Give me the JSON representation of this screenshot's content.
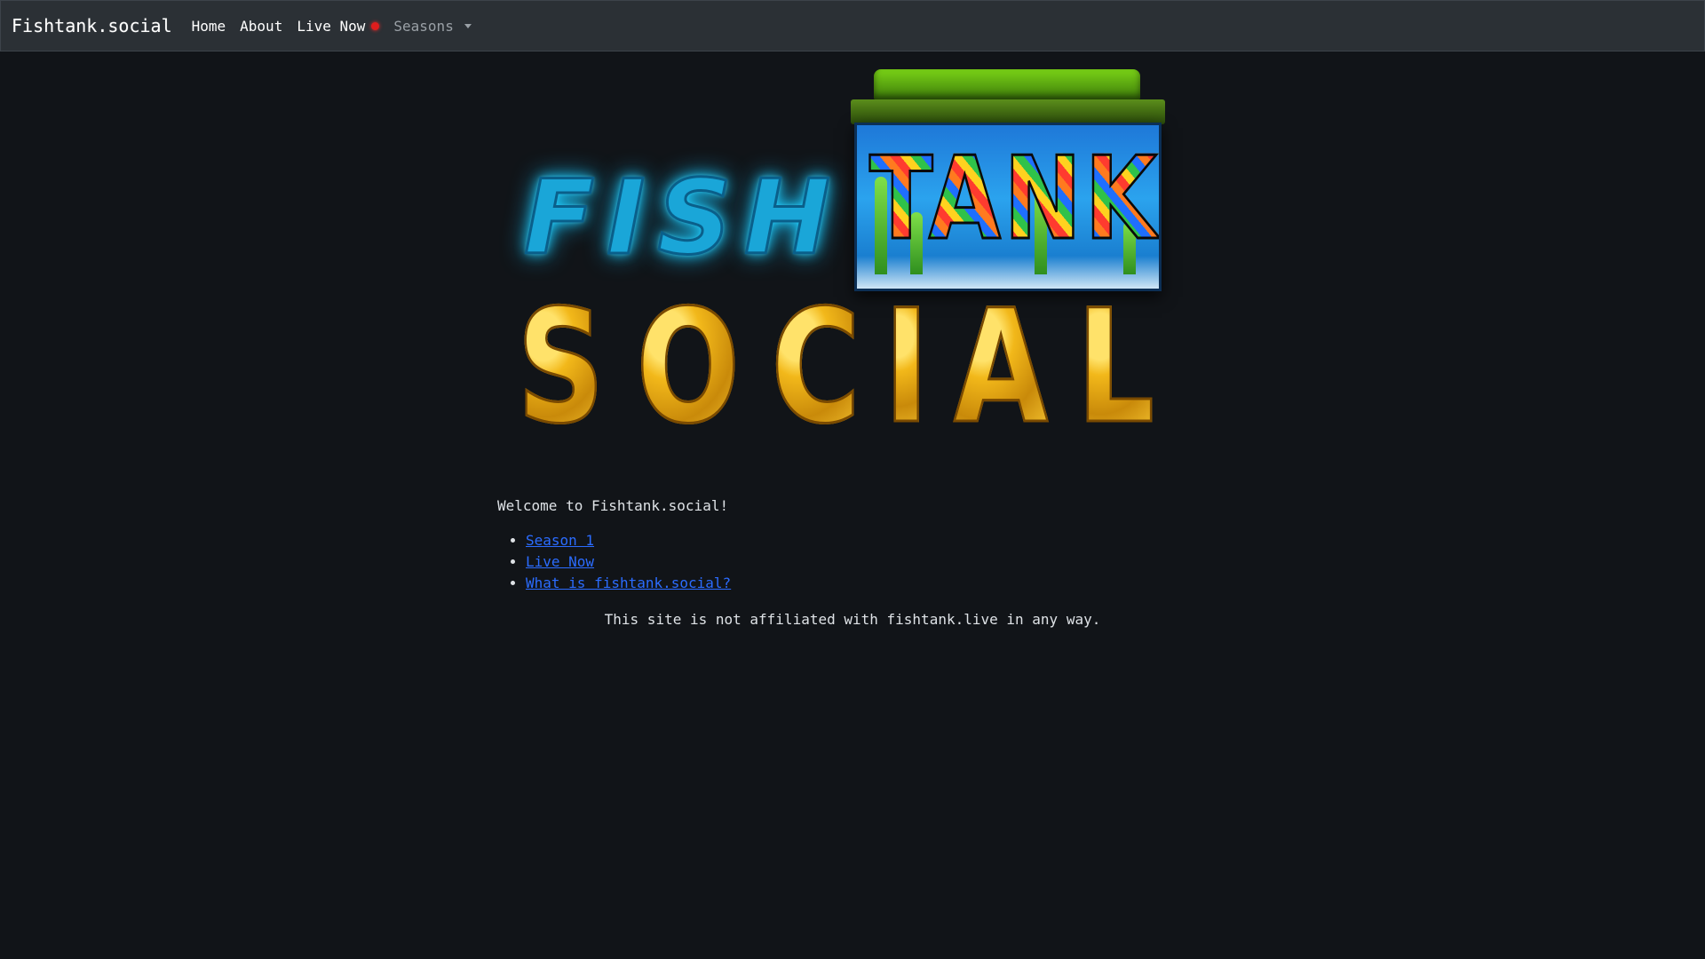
{
  "navbar": {
    "brand": "Fishtank.social",
    "items": [
      {
        "label": "Home"
      },
      {
        "label": "About"
      },
      {
        "label": "Live Now"
      },
      {
        "label": "Seasons"
      }
    ],
    "live_indicator_color": "#e11d1d"
  },
  "logo": {
    "word_top_left": "FISH",
    "word_top_right": "TANK",
    "word_bottom": [
      "S",
      "O",
      "C",
      "I",
      "A",
      "L"
    ]
  },
  "main": {
    "welcome": "Welcome to Fishtank.social!",
    "links": [
      {
        "label": "Season 1"
      },
      {
        "label": "Live Now"
      },
      {
        "label": "What is fishtank.social?"
      }
    ],
    "disclaimer": "This site is not affiliated with fishtank.live in any way."
  },
  "colors": {
    "background": "#111418",
    "navbar": "#2b3035",
    "link": "#2b6cff"
  }
}
